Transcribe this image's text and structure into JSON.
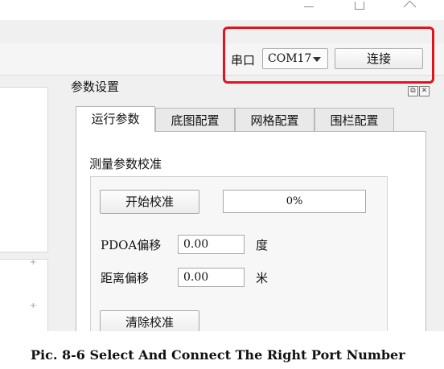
{
  "toolbar": {
    "port_label": "串口",
    "port_value": "COM17",
    "connect_label": "连接"
  },
  "panel": {
    "title": "参数设置",
    "tabs": [
      {
        "label": "运行参数",
        "active": true
      },
      {
        "label": "底图配置",
        "active": false
      },
      {
        "label": "网格配置",
        "active": false
      },
      {
        "label": "围栏配置",
        "active": false
      }
    ]
  },
  "calibration": {
    "group_title": "测量参数校准",
    "start_label": "开始校准",
    "progress_text": "0%",
    "pdoa_label": "PDOA偏移",
    "pdoa_value": "0.00",
    "pdoa_unit": "度",
    "distance_label": "距离偏移",
    "distance_value": "0.00",
    "distance_unit": "米",
    "clear_label": "清除校准"
  },
  "caption": "Pic. 8-6 Select And Connect The Right Port Number",
  "colors": {
    "highlight": "#e0141e"
  }
}
